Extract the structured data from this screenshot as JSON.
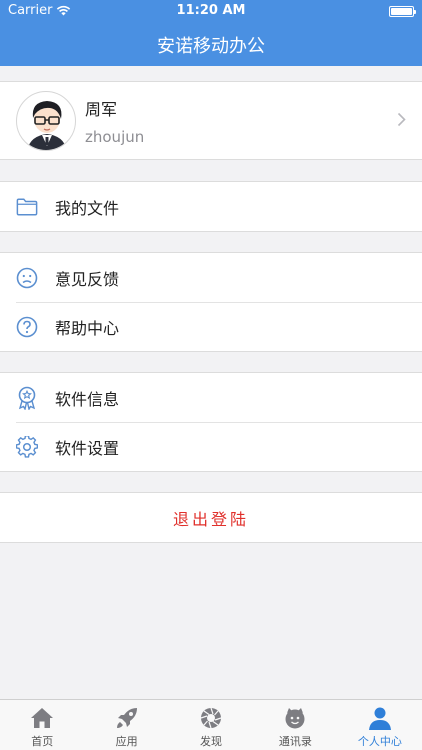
{
  "status_bar": {
    "carrier": "Carrier",
    "time": "11:20 AM"
  },
  "header": {
    "title": "安诺移动办公"
  },
  "profile": {
    "name": "周军",
    "username": "zhoujun"
  },
  "menu": {
    "files": {
      "label": "我的文件",
      "icon": "folder-icon"
    },
    "feedback": {
      "label": "意见反馈",
      "icon": "sad-face-icon"
    },
    "help": {
      "label": "帮助中心",
      "icon": "question-circle-icon"
    },
    "software_info": {
      "label": "软件信息",
      "icon": "award-badge-icon"
    },
    "software_settings": {
      "label": "软件设置",
      "icon": "gear-icon"
    }
  },
  "logout": {
    "label": "退出登陆"
  },
  "tabs": [
    {
      "label": "首页",
      "icon": "home-icon"
    },
    {
      "label": "应用",
      "icon": "rocket-icon"
    },
    {
      "label": "发现",
      "icon": "aperture-icon"
    },
    {
      "label": "通讯录",
      "icon": "contacts-face-icon"
    },
    {
      "label": "个人中心",
      "icon": "person-icon",
      "active": true
    }
  ],
  "colors": {
    "primary": "#4a90e2",
    "logout": "#e0302b",
    "active_tab": "#2f7fd8",
    "icon": "#5b8fd0"
  }
}
